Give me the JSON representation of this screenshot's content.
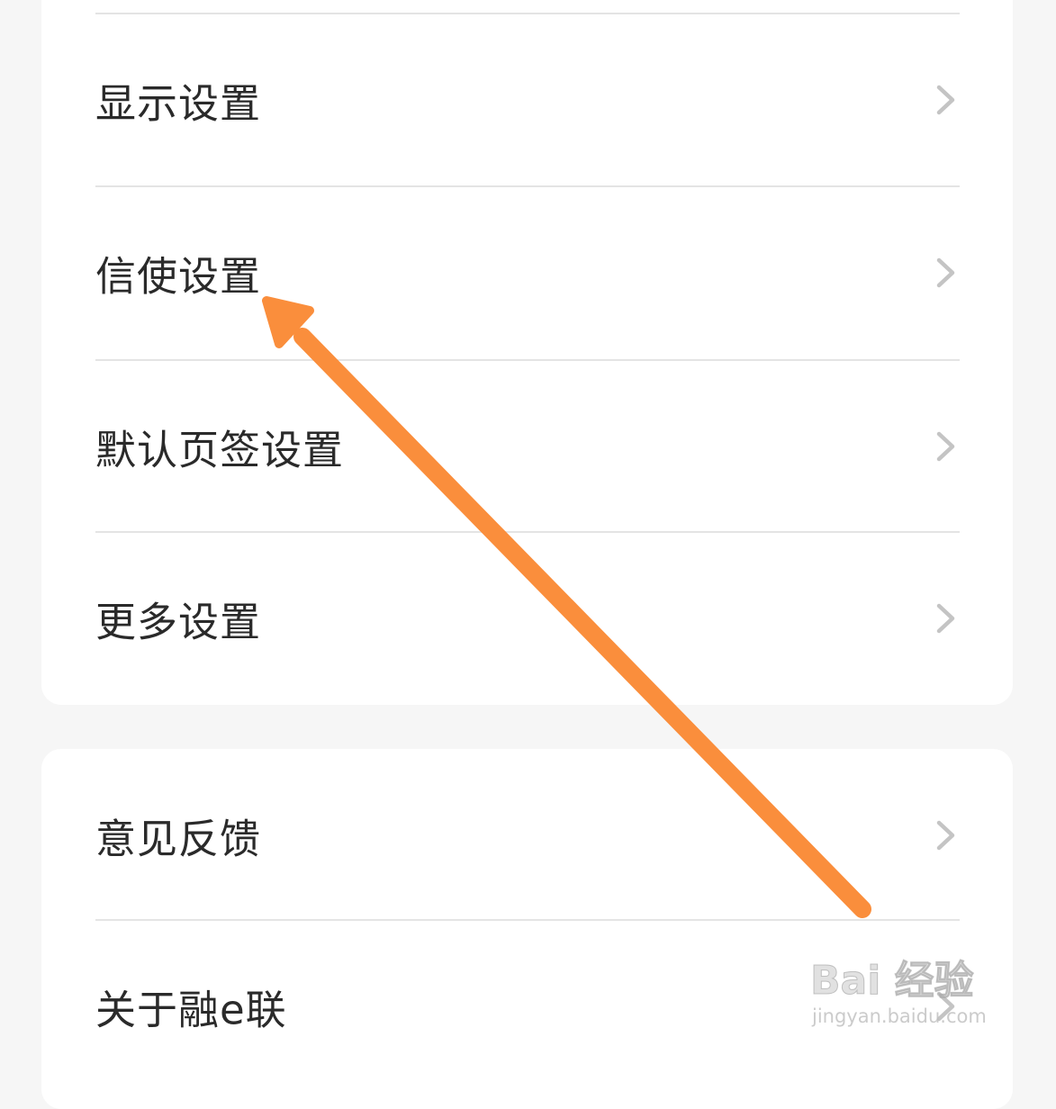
{
  "group1": {
    "items": [
      {
        "label": "显示设置",
        "icon": "chevron-right-icon"
      },
      {
        "label": "信使设置",
        "icon": "chevron-right-icon"
      },
      {
        "label": "默认页签设置",
        "icon": "chevron-right-icon"
      },
      {
        "label": "更多设置",
        "icon": "chevron-right-icon"
      }
    ]
  },
  "group2": {
    "items": [
      {
        "label": "意见反馈",
        "icon": "chevron-right-icon"
      },
      {
        "label": "关于融e联",
        "icon": "chevron-right-icon"
      }
    ]
  },
  "annotation": {
    "arrow_color": "#fa8e3c",
    "target": "信使设置"
  },
  "watermark": {
    "logo": "Bai 经验",
    "url": "jingyan.baidu.com"
  },
  "colors": {
    "background": "#f6f6f6",
    "card": "#ffffff",
    "text": "#2a2a2a",
    "chevron": "#c4c4c4",
    "divider": "#e4e4e4"
  }
}
